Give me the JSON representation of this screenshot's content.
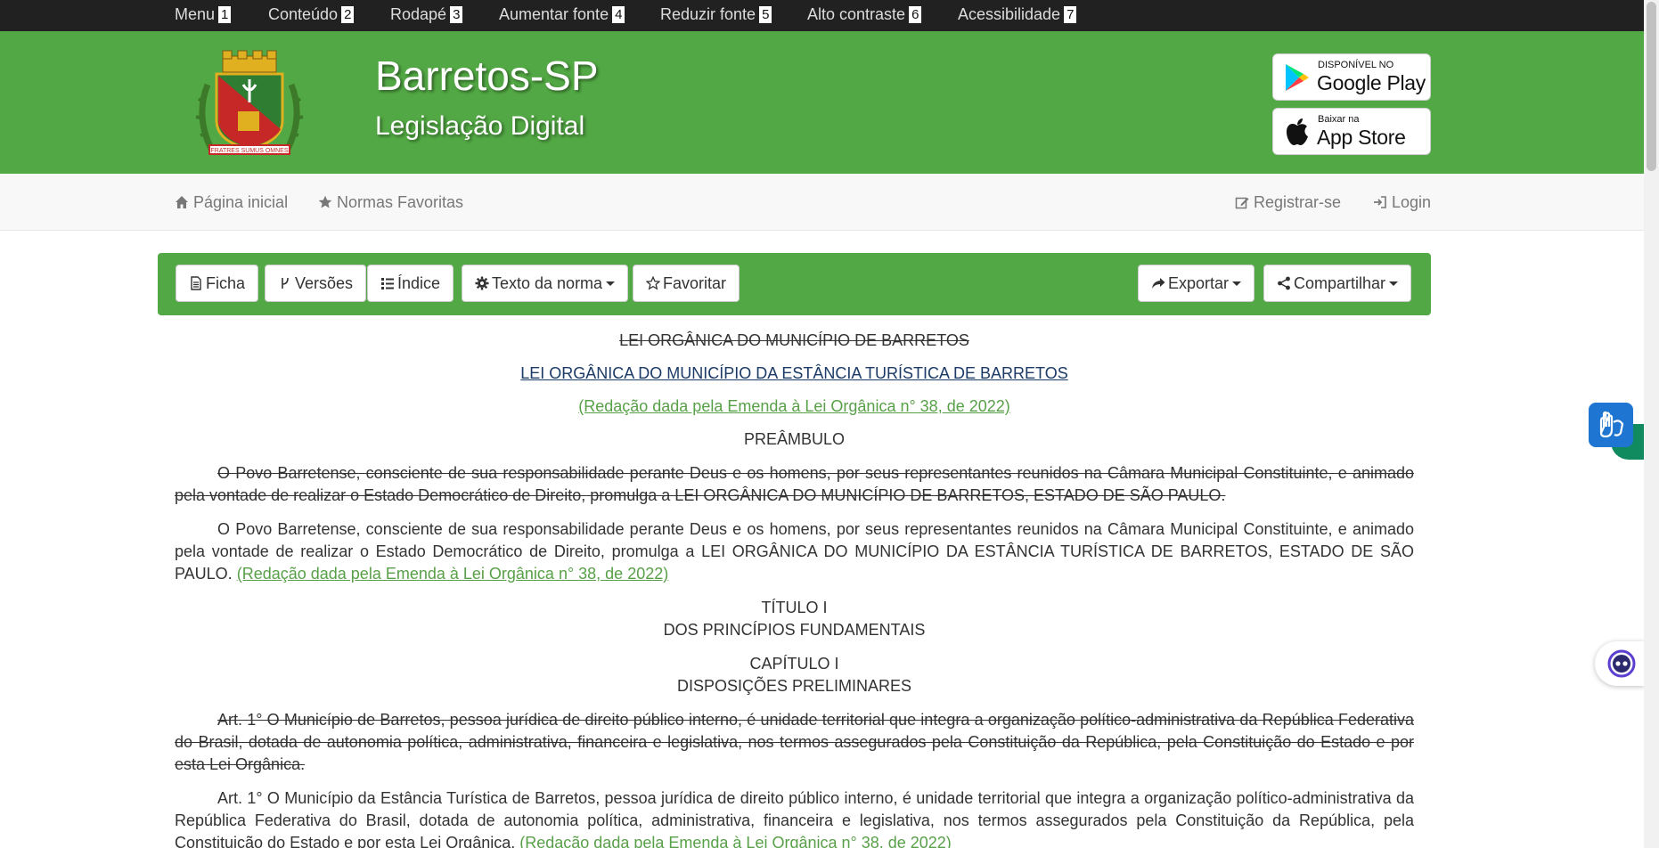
{
  "accessibility_bar": {
    "items": [
      {
        "label": "Menu",
        "key": "1"
      },
      {
        "label": "Conteúdo",
        "key": "2"
      },
      {
        "label": "Rodapé",
        "key": "3"
      },
      {
        "label": "Aumentar fonte",
        "key": "4"
      },
      {
        "label": "Reduzir fonte",
        "key": "5"
      },
      {
        "label": "Alto contraste",
        "key": "6"
      },
      {
        "label": "Acessibilidade",
        "key": "7"
      }
    ]
  },
  "header": {
    "title": "Barretos-SP",
    "subtitle": "Legislação Digital",
    "coat_motto": "FRATRES SUMUS OMNES",
    "google_play": {
      "small": "DISPONÍVEL NO",
      "big": "Google Play"
    },
    "app_store": {
      "small": "Baixar na",
      "big": "App Store"
    },
    "bg_color": "#52a844"
  },
  "nav": {
    "home": "Página inicial",
    "favorites": "Normas Favoritas",
    "register": "Registrar-se",
    "login": "Login"
  },
  "toolbar": {
    "ficha": "Ficha",
    "versoes": "Versões",
    "indice": "Índice",
    "texto_norma": "Texto da norma",
    "favoritar": "Favoritar",
    "exportar": "Exportar",
    "compartilhar": "Compartilhar"
  },
  "document": {
    "title_old": "LEI ORGÂNICA DO MUNICÍPIO DE BARRETOS",
    "title_new": "LEI ORGÂNICA DO MUNICÍPIO DA ESTÂNCIA TURÍSTICA DE BARRETOS",
    "amendment_note": "(Redação dada pela Emenda à Lei Orgânica n° 38, de 2022)",
    "preambulo": "PREÂMBULO",
    "preambulo_old": "O Povo Barretense, consciente de sua responsabilidade perante Deus e os homens, por seus representantes reunidos na Câmara Municipal Constituinte, e animado pela vontade de realizar o Estado Democrático de Direito, promulga a LEI ORGÂNICA DO MUNICÍPIO DE BARRETOS, ESTADO DE SÃO PAULO.",
    "preambulo_new": "O Povo Barretense, consciente de sua responsabilidade perante Deus e os homens, por seus representantes reunidos na Câmara Municipal Constituinte, e animado pela vontade de realizar o Estado Democrático de Direito, promulga a LEI ORGÂNICA DO MUNICÍPIO DA ESTÂNCIA TURÍSTICA DE BARRETOS, ESTADO DE SÃO PAULO.",
    "titulo": "TÍTULO I",
    "titulo_name": "DOS PRINCÍPIOS FUNDAMENTAIS",
    "capitulo": "CAPÍTULO I",
    "capitulo_name": "DISPOSIÇÕES PRELIMINARES",
    "art1_old": "Art. 1°  O Município de Barretos, pessoa jurídica de direito público interno, é unidade territorial que integra a organização político-administrativa da República Federativa do Brasil, dotada de autonomia política, administrativa, financeira e legislativa, nos termos assegurados pela Constituição da República, pela Constituição do Estado e por esta Lei Orgânica.",
    "art1_new": "Art. 1°  O Município da Estância Turística de Barretos, pessoa jurídica de direito público interno, é unidade territorial que integra a organização político-administrativa da República Federativa do Brasil, dotada de autonomia política, administrativa, financeira e legislativa, nos termos assegurados pela Constituição da República, pela Constituição do Estado e por esta Lei Orgânica."
  }
}
